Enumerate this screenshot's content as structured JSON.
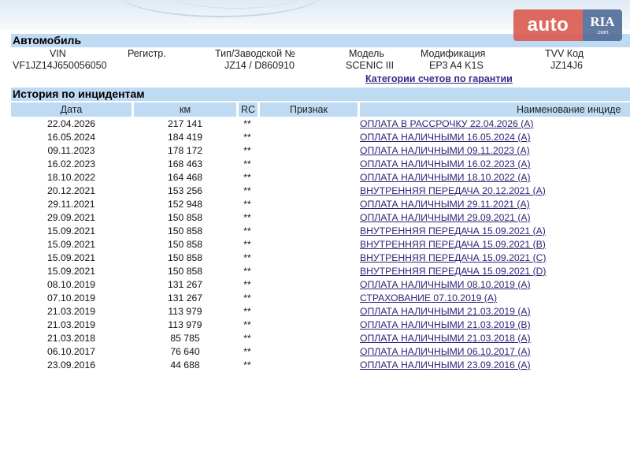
{
  "logo": {
    "auto": "auto",
    "ria": "RIA",
    "ria_sub": ".com"
  },
  "vehicle": {
    "title": "Автомобиль",
    "headers": {
      "vin": "VIN",
      "reg": "Регистр.",
      "type": "Тип/Заводской №",
      "model": "Модель",
      "mod": "Модификация",
      "tvv": "TVV Код"
    },
    "values": {
      "vin": "VF1JZ14J650056050",
      "reg": "",
      "type": "JZ14 / D860910",
      "model": "SCENIC III",
      "mod": "EP3 A4 K1S",
      "tvv": "JZ14J6"
    },
    "warranty_link": "Категории счетов по гарантии"
  },
  "incidents": {
    "title": "История по инцидентам",
    "columns": {
      "date": "Дата",
      "km": "км",
      "rc": "RC",
      "sign": "Признак",
      "name": "Наименование инциде"
    },
    "rows": [
      {
        "date": "22.04.2026",
        "km": "217 141",
        "rc": "**",
        "name": "ОПЛАТА В РАССРОЧКУ 22.04.2026 (A)"
      },
      {
        "date": "16.05.2024",
        "km": "184 419",
        "rc": "**",
        "name": "ОПЛАТА НАЛИЧНЫМИ 16.05.2024 (A)"
      },
      {
        "date": "09.11.2023",
        "km": "178 172",
        "rc": "**",
        "name": "ОПЛАТА НАЛИЧНЫМИ 09.11.2023 (A)"
      },
      {
        "date": "16.02.2023",
        "km": "168 463",
        "rc": "**",
        "name": "ОПЛАТА НАЛИЧНЫМИ 16.02.2023 (A)"
      },
      {
        "date": "18.10.2022",
        "km": "164 468",
        "rc": "**",
        "name": "ОПЛАТА НАЛИЧНЫМИ 18.10.2022 (A)"
      },
      {
        "date": "20.12.2021",
        "km": "153 256",
        "rc": "**",
        "name": "ВНУТРЕННЯЯ ПЕРЕДАЧА 20.12.2021 (A)"
      },
      {
        "date": "29.11.2021",
        "km": "152 948",
        "rc": "**",
        "name": "ОПЛАТА НАЛИЧНЫМИ 29.11.2021 (A)"
      },
      {
        "date": "29.09.2021",
        "km": "150 858",
        "rc": "**",
        "name": "ОПЛАТА НАЛИЧНЫМИ 29.09.2021 (A)"
      },
      {
        "date": "15.09.2021",
        "km": "150 858",
        "rc": "**",
        "name": "ВНУТРЕННЯЯ ПЕРЕДАЧА 15.09.2021 (A)"
      },
      {
        "date": "15.09.2021",
        "km": "150 858",
        "rc": "**",
        "name": "ВНУТРЕННЯЯ ПЕРЕДАЧА 15.09.2021 (B)"
      },
      {
        "date": "15.09.2021",
        "km": "150 858",
        "rc": "**",
        "name": "ВНУТРЕННЯЯ ПЕРЕДАЧА 15.09.2021 (C)"
      },
      {
        "date": "15.09.2021",
        "km": "150 858",
        "rc": "**",
        "name": "ВНУТРЕННЯЯ ПЕРЕДАЧА 15.09.2021 (D)"
      },
      {
        "date": "08.10.2019",
        "km": "131 267",
        "rc": "**",
        "name": "ОПЛАТА НАЛИЧНЫМИ 08.10.2019 (A)"
      },
      {
        "date": "07.10.2019",
        "km": "131 267",
        "rc": "**",
        "name": "СТРАХОВАНИЕ 07.10.2019 (A)"
      },
      {
        "date": "21.03.2019",
        "km": "113 979",
        "rc": "**",
        "name": "ОПЛАТА НАЛИЧНЫМИ 21.03.2019 (A)"
      },
      {
        "date": "21.03.2019",
        "km": "113 979",
        "rc": "**",
        "name": "ОПЛАТА НАЛИЧНЫМИ 21.03.2019 (B)"
      },
      {
        "date": "21.03.2018",
        "km": "85 785",
        "rc": "**",
        "name": "ОПЛАТА НАЛИЧНЫМИ 21.03.2018 (A)"
      },
      {
        "date": "06.10.2017",
        "km": "76 640",
        "rc": "**",
        "name": "ОПЛАТА НАЛИЧНЫМИ 06.10.2017 (A)"
      },
      {
        "date": "23.09.2016",
        "km": "44 688",
        "rc": "**",
        "name": "ОПЛАТА НАЛИЧНЫМИ 23.09.2016 (A)"
      }
    ]
  }
}
